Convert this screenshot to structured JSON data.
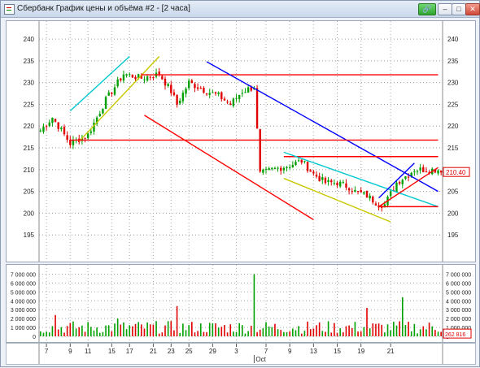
{
  "window": {
    "title": "Сбербанк График цены и объёма #2 - [2 часа]",
    "buttons": {
      "minimize": "–",
      "maximize": "□",
      "close": "✕"
    }
  },
  "price_axis": {
    "ticks": [
      "240",
      "235",
      "230",
      "225",
      "220",
      "215",
      "210",
      "205",
      "200",
      "195"
    ],
    "last_price": "210.40"
  },
  "volume_axis": {
    "ticks": [
      "7 000 000",
      "6 000 000",
      "5 000 000",
      "4 000 000",
      "3 000 000",
      "2 000 000",
      "1 000 000",
      "0"
    ],
    "last_volume": "262 816"
  },
  "time_axis": {
    "dates": [
      "7",
      "9",
      "11",
      "15",
      "17",
      "21",
      "23",
      "25",
      "29",
      "3",
      "7",
      "9",
      "13",
      "15",
      "19",
      "21"
    ],
    "month_label": "Oct"
  },
  "chart_data": {
    "type": "candlestick",
    "series": "price",
    "ylim": [
      190,
      243
    ],
    "anchors": [
      [
        0,
        219
      ],
      [
        4,
        222
      ],
      [
        8,
        218
      ],
      [
        10,
        216
      ],
      [
        16,
        218
      ],
      [
        22,
        226
      ],
      [
        28,
        232
      ],
      [
        34,
        231
      ],
      [
        40,
        232
      ],
      [
        44,
        228
      ],
      [
        46,
        225
      ],
      [
        50,
        230
      ],
      [
        56,
        228
      ],
      [
        60,
        227
      ],
      [
        64,
        225
      ],
      [
        68,
        228
      ],
      [
        72,
        229
      ],
      [
        74,
        209
      ],
      [
        78,
        210
      ],
      [
        84,
        211
      ],
      [
        88,
        212
      ],
      [
        92,
        209
      ],
      [
        96,
        207
      ],
      [
        100,
        207
      ],
      [
        104,
        206
      ],
      [
        106,
        205
      ],
      [
        110,
        204
      ],
      [
        114,
        202
      ],
      [
        116,
        202
      ],
      [
        120,
        207
      ],
      [
        126,
        210
      ],
      [
        130,
        210
      ]
    ],
    "volume": {
      "ylim": [
        0,
        7500000
      ],
      "typical": 1200000,
      "spikes": [
        {
          "bar": 5,
          "value": 2400000
        },
        {
          "bar": 26,
          "value": 2000000
        },
        {
          "bar": 46,
          "value": 3400000
        },
        {
          "bar": 72,
          "value": 7000000
        },
        {
          "bar": 110,
          "value": 3200000
        },
        {
          "bar": 122,
          "value": 4400000
        }
      ]
    },
    "trendlines": [
      {
        "color": "#00c8d0",
        "from": [
          10,
          223.5
        ],
        "to": [
          30,
          236
        ]
      },
      {
        "color": "#c8c800",
        "from": [
          13,
          216.5
        ],
        "to": [
          40,
          236
        ]
      },
      {
        "color": "#ff0000",
        "from": [
          34,
          231.8
        ],
        "to": [
          134,
          231.8
        ]
      },
      {
        "color": "#0000ff",
        "from": [
          56,
          234.8
        ],
        "to": [
          134,
          205
        ]
      },
      {
        "color": "#ff0000",
        "from": [
          35,
          222.5
        ],
        "to": [
          92,
          198.5
        ]
      },
      {
        "color": "#ff0000",
        "from": [
          10,
          216.8
        ],
        "to": [
          134,
          216.8
        ]
      },
      {
        "color": "#ff0000",
        "from": [
          82,
          213
        ],
        "to": [
          134,
          213
        ]
      },
      {
        "color": "#00c8d0",
        "from": [
          82,
          214
        ],
        "to": [
          134,
          201.5
        ]
      },
      {
        "color": "#c8c800",
        "from": [
          82,
          208
        ],
        "to": [
          118,
          198
        ]
      },
      {
        "color": "#ff0000",
        "from": [
          114,
          201.5
        ],
        "to": [
          134,
          201.5
        ]
      },
      {
        "color": "#0000ff",
        "from": [
          114,
          203.5
        ],
        "to": [
          126,
          211.5
        ]
      },
      {
        "color": "#ff0000",
        "from": [
          114,
          201.5
        ],
        "to": [
          134,
          210.5
        ]
      }
    ]
  }
}
